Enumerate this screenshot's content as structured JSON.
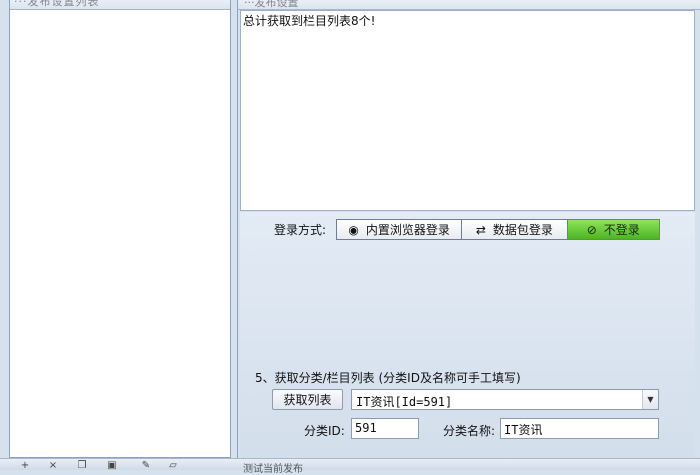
{
  "left_panel": {
    "header_partial": "···发布设置列表"
  },
  "right_panel": {
    "header_partial": "···发布设置",
    "log_text": "总计获取到栏目列表8个!"
  },
  "login": {
    "label": "登录方式:",
    "options": [
      {
        "label": "内置浏览器登录",
        "icon": "globe-icon"
      },
      {
        "label": "数据包登录",
        "icon": "shuffle-icon"
      },
      {
        "label": "不登录",
        "icon": "no-entry-icon",
        "selected": true
      }
    ]
  },
  "category": {
    "section_title": "5、获取分类/栏目列表 (分类ID及名称可手工填写)",
    "fetch_button": "获取列表",
    "selected_value": "IT资讯[Id=591]",
    "id_label": "分类ID:",
    "id_value": "591",
    "name_label": "分类名称:",
    "name_value": "IT资讯"
  },
  "bottom_bar": {
    "caption": "测试当前发布",
    "icons": [
      "add-icon",
      "delete-icon",
      "copy-icon",
      "save-icon",
      "edit-icon",
      "trash-icon"
    ]
  },
  "colors": {
    "active_green": "#4cb521",
    "panel_bg": "#d6e1ee",
    "border": "#8ea3bd"
  }
}
